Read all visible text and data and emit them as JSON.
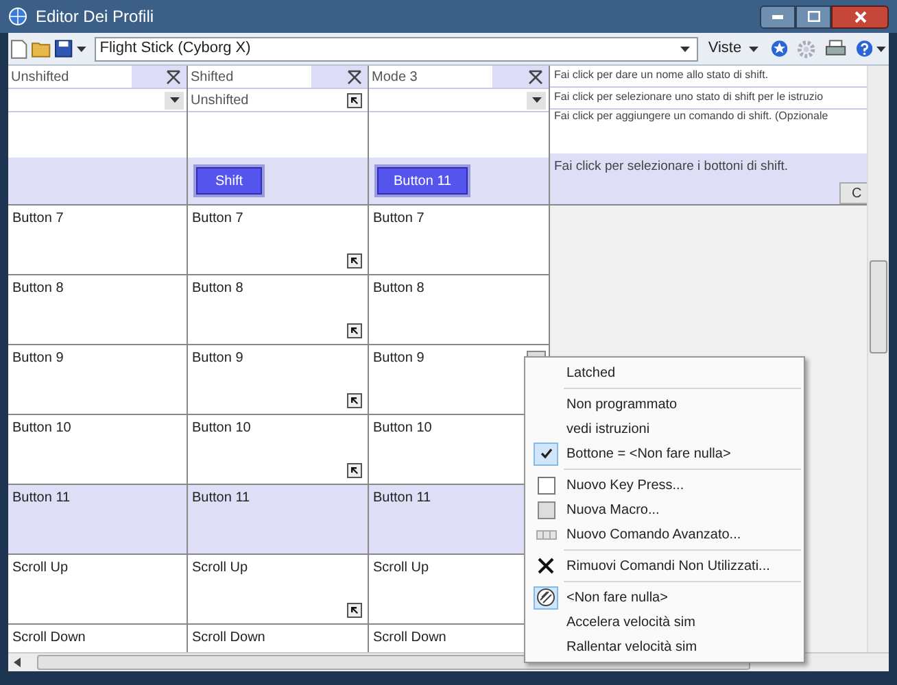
{
  "window": {
    "title": "Editor Dei Profili"
  },
  "toolbar": {
    "profile": "Flight Stick (Cyborg X)",
    "views": "Viste"
  },
  "shift_states": [
    {
      "name": "Unshifted",
      "source": {
        "kind": "dropdown"
      }
    },
    {
      "name": "Shifted",
      "source": {
        "kind": "link",
        "value": "Unshifted"
      },
      "shift_button": "Shift"
    },
    {
      "name": "Mode 3",
      "source": {
        "kind": "dropdown"
      },
      "shift_button": "Button 11"
    }
  ],
  "hints": [
    "Fai click per dare un nome allo stato di shift.",
    "Fai click per selezionare uno stato di shift per le istruzio",
    "Fai click per aggiungere un comando di shift. (Opzionale",
    "Fai click per selezionare i bottoni di shift."
  ],
  "hint_button": "C",
  "rows": [
    {
      "selected": false,
      "cells": [
        {
          "label": "Button 7",
          "kind": "plain"
        },
        {
          "label": "Button 7",
          "kind": "linked"
        },
        {
          "label": "Button 7",
          "kind": "plain"
        }
      ]
    },
    {
      "selected": false,
      "cells": [
        {
          "label": "Button 8",
          "kind": "plain"
        },
        {
          "label": "Button 8",
          "kind": "linked"
        },
        {
          "label": "Button 8",
          "kind": "plain"
        }
      ]
    },
    {
      "selected": false,
      "cells": [
        {
          "label": "Button 9",
          "kind": "plain"
        },
        {
          "label": "Button 9",
          "kind": "linked"
        },
        {
          "label": "Button 9",
          "kind": "menu"
        }
      ]
    },
    {
      "selected": false,
      "cells": [
        {
          "label": "Button 10",
          "kind": "plain"
        },
        {
          "label": "Button 10",
          "kind": "linked"
        },
        {
          "label": "Button 10",
          "kind": "plain"
        }
      ]
    },
    {
      "selected": true,
      "cells": [
        {
          "label": "Button 11",
          "kind": "plain"
        },
        {
          "label": "Button 11",
          "kind": "plain"
        },
        {
          "label": "Button 11",
          "kind": "plain"
        }
      ]
    },
    {
      "selected": false,
      "cells": [
        {
          "label": "Scroll Up",
          "kind": "plain"
        },
        {
          "label": "Scroll Up",
          "kind": "linked"
        },
        {
          "label": "Scroll Up",
          "kind": "plain"
        }
      ]
    },
    {
      "selected": false,
      "cells": [
        {
          "label": "Scroll Down",
          "kind": "plain"
        },
        {
          "label": "Scroll Down",
          "kind": "plain"
        },
        {
          "label": "Scroll Down",
          "kind": "plain"
        }
      ]
    }
  ],
  "context_menu": {
    "items": [
      {
        "kind": "item",
        "label": "Latched",
        "checked": false
      },
      {
        "kind": "separator"
      },
      {
        "kind": "item",
        "label": "Non programmato",
        "checked": false
      },
      {
        "kind": "item",
        "label": "vedi istruzioni",
        "checked": false
      },
      {
        "kind": "item",
        "label": "Bottone = <Non fare nulla>",
        "checked": true
      },
      {
        "kind": "separator"
      },
      {
        "kind": "keypress",
        "label": "Nuovo Key Press...",
        "checked": false
      },
      {
        "kind": "macro",
        "label": "Nuova Macro...",
        "checked": false
      },
      {
        "kind": "advanced",
        "label": "Nuovo Comando Avanzato...",
        "checked": false
      },
      {
        "kind": "separator"
      },
      {
        "kind": "remove",
        "label": "Rimuovi Comandi Non Utilizzati...",
        "checked": false
      },
      {
        "kind": "separator"
      },
      {
        "kind": "nothing",
        "label": "<Non fare nulla>",
        "checked": true
      },
      {
        "kind": "item",
        "label": "Accelera velocità sim",
        "checked": false
      },
      {
        "kind": "item",
        "label": "Rallentar velocità sim",
        "checked": false
      }
    ]
  }
}
